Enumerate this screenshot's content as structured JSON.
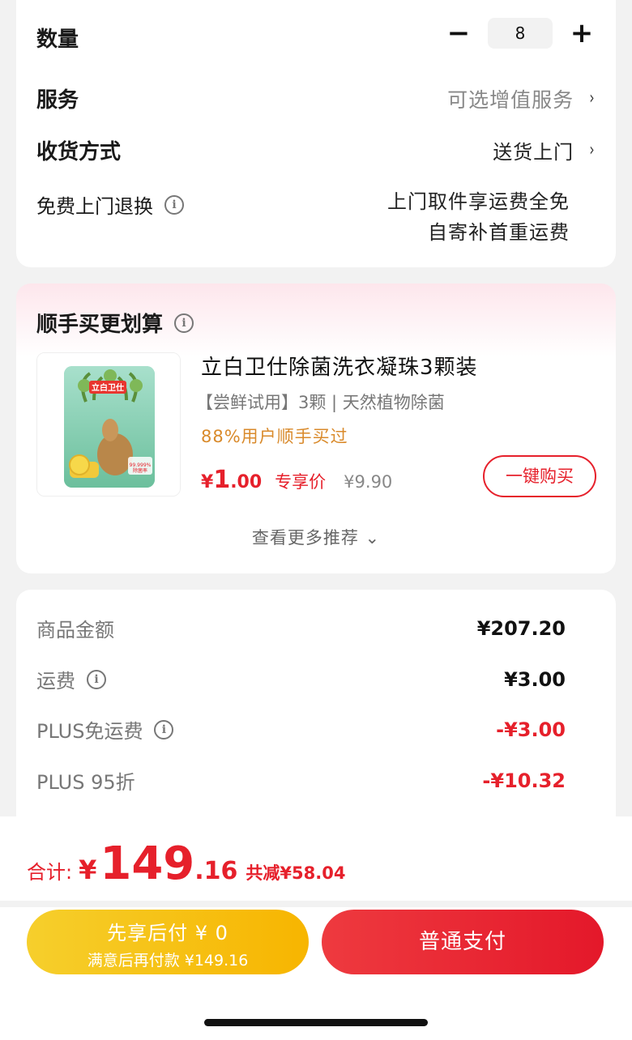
{
  "options": {
    "quantity_label": "数量",
    "quantity_value": "8",
    "minus": "−",
    "plus": "+",
    "service_label": "服务",
    "service_value": "可选增值服务",
    "delivery_label": "收货方式",
    "delivery_value": "送货上门",
    "return_label": "免费上门退换",
    "return_line1": "上门取件享运费全免",
    "return_line2": "自寄补首重运费",
    "chevron": "›",
    "info": "i"
  },
  "upsell": {
    "title": "顺手买更划算",
    "product": {
      "name": "立白卫仕除菌洗衣凝珠3颗装",
      "subtitle": "【尝鲜试用】3颗 | 天然植物除菌",
      "popularity": "88%用户顺手买过",
      "price_symbol": "¥",
      "price_int": "1",
      "price_dec": ".00",
      "price_tag": "专享价",
      "original_price": "¥9.90",
      "buy_label": "一键购买",
      "image_brand": "立白卫仕",
      "image_badge": "99.999% 除菌率"
    },
    "more_label": "查看更多推荐 ⌄"
  },
  "summary": {
    "rows": [
      {
        "label": "商品金额",
        "value": "¥207.20",
        "info": false,
        "red": false
      },
      {
        "label": "运费",
        "value": "¥3.00",
        "info": true,
        "red": false
      },
      {
        "label": "PLUS免运费",
        "value": "-¥3.00",
        "info": true,
        "red": true
      },
      {
        "label": "PLUS 95折",
        "value": "-¥10.32",
        "info": false,
        "red": true
      }
    ]
  },
  "footer": {
    "total_label": "合计:",
    "total_symbol": "¥",
    "total_int": "149",
    "total_dec": ".16",
    "total_saved": "共减¥58.04",
    "pay_later_main": "先享后付 ¥ 0",
    "pay_later_sub": "满意后再付款 ¥149.16",
    "pay_now": "普通支付"
  },
  "colors": {
    "accent_red": "#e6202b",
    "pay_later_yellow": "#f7b500",
    "popularity_orange": "#d98a2b"
  }
}
